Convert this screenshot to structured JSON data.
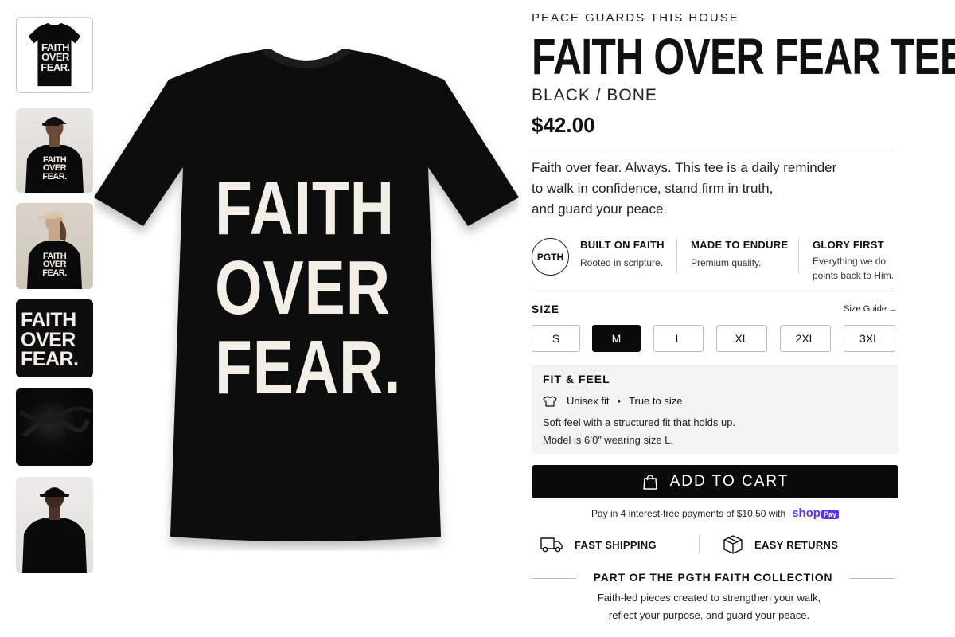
{
  "gallery": {
    "thumbnails": [
      {
        "label_lines": [
          "FAITH",
          "OVER",
          "FEAR."
        ],
        "kind": "flat-tee"
      },
      {
        "label_lines": [
          "FAITH",
          "OVER",
          "FEAR."
        ],
        "kind": "model-cap"
      },
      {
        "label_lines": [
          "FAITH",
          "OVER",
          "FEAR."
        ],
        "kind": "model-beige-cap"
      },
      {
        "label_lines": [
          "FAITH",
          "OVER",
          "FEAR."
        ],
        "kind": "print-closeup"
      },
      {
        "label_lines": [],
        "kind": "fabric-closeup"
      },
      {
        "label_lines": [],
        "kind": "back-view"
      }
    ],
    "main_graphic_lines": [
      "FAITH",
      "OVER",
      "FEAR."
    ]
  },
  "product": {
    "brand": "PEACE GUARDS THIS HOUSE",
    "title": "FAITH OVER FEAR TEE",
    "variant": "BLACK / BONE",
    "price": "$42.00",
    "description": [
      "Faith over fear. Always. This tee is a daily reminder",
      "to walk in confidence, stand firm in truth,",
      "and guard your peace."
    ]
  },
  "values": {
    "badge": "PGTH",
    "items": [
      {
        "title": "BUILT ON FAITH",
        "sub": "Rooted in scripture."
      },
      {
        "title": "MADE TO ENDURE",
        "sub": "Premium quality."
      },
      {
        "title": "GLORY FIRST",
        "sub_lines": [
          "Everything we do",
          "points back to Him."
        ]
      }
    ]
  },
  "size": {
    "label": "SIZE",
    "guide": "Size Guide →",
    "options": [
      "S",
      "M",
      "L",
      "XL",
      "2XL",
      "3XL"
    ],
    "selected": "M"
  },
  "fit": {
    "heading": "FIT & FEEL",
    "fit_type": "Unisex fit",
    "bullet": "•",
    "sizing": "True to size",
    "line1": "Soft feel with a structured fit that holds up.",
    "line2": "Model is 6’0” wearing size L."
  },
  "cart": {
    "add_to_cart": "ADD TO CART",
    "installments": "Pay in 4 interest-free payments of $10.50 with",
    "shop_brand": "shop",
    "shop_pay": "Pay"
  },
  "perks": {
    "shipping": "FAST SHIPPING",
    "returns": "EASY RETURNS"
  },
  "collection": {
    "heading": "PART OF THE PGTH FAITH COLLECTION",
    "lines": [
      "Faith-led pieces created to strengthen your walk,",
      "reflect your purpose, and guard your peace."
    ]
  },
  "colors": {
    "ink": "#0a0a0a",
    "bone": "#f3efe6",
    "shop_pay": "#5a31f4",
    "panel": "#f3f3f3"
  }
}
